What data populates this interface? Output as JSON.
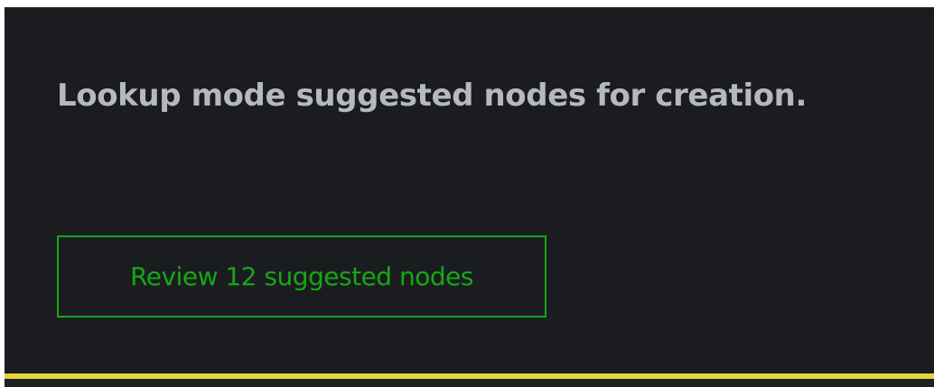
{
  "notice": {
    "message": "Lookup mode suggested nodes for creation.",
    "review_button_label": "Review 12 suggested nodes"
  },
  "colors": {
    "panel_background": "#1b1c20",
    "message_text": "#b5b8bd",
    "button_accent": "#14a814",
    "status_bar": "#e3d53a"
  }
}
